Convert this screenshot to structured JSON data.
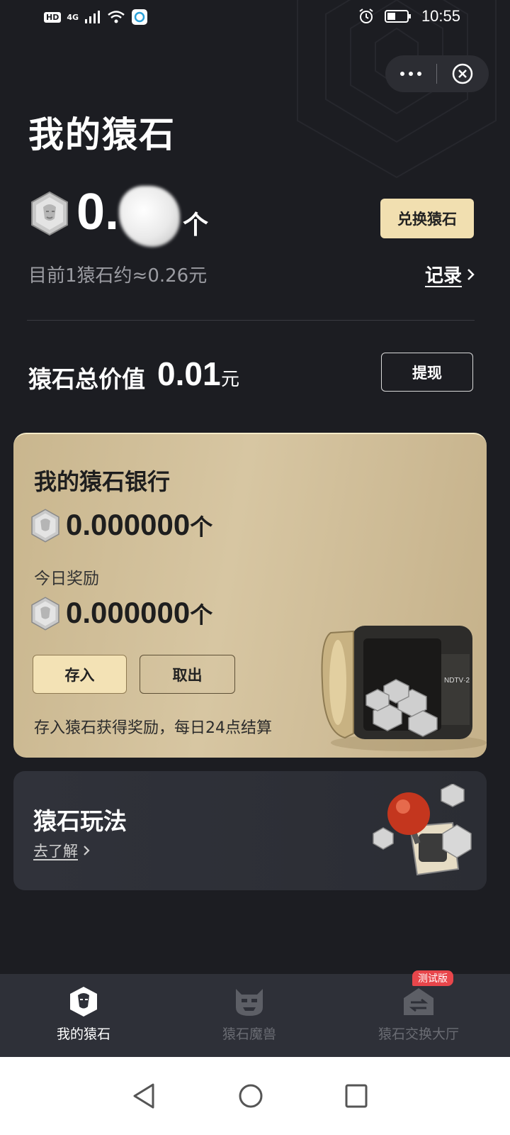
{
  "status_bar": {
    "left_badge_hd": "HD",
    "left_network": "4G",
    "time": "10:55"
  },
  "page": {
    "title": "我的猿石"
  },
  "balance": {
    "amount_visible": "0.",
    "unit": "个",
    "exchange_button": "兑换猿石",
    "rate_text": "目前1猿石约≈0.26元",
    "record_link": "记录"
  },
  "total_value": {
    "label": "猿石总价值",
    "value": "0.01",
    "unit": "元",
    "withdraw_button": "提现"
  },
  "bank": {
    "title": "我的猿石银行",
    "amount": "0.000000",
    "amount_unit": "个",
    "reward_label": "今日奖励",
    "reward_amount": "0.000000",
    "reward_unit": "个",
    "deposit_button": "存入",
    "takeout_button": "取出",
    "note": "存入猿石获得奖励，每日24点结算",
    "safe_label": "NDTV·2"
  },
  "play": {
    "title": "猿石玩法",
    "link": "去了解"
  },
  "tabs": [
    {
      "label": "我的猿石",
      "icon": "ape-stone-icon",
      "active": true
    },
    {
      "label": "猿石魔兽",
      "icon": "monster-icon",
      "active": false
    },
    {
      "label": "猿石交换大厅",
      "icon": "exchange-hall-icon",
      "active": false
    }
  ],
  "test_badge": "测试版",
  "colors": {
    "background": "#1c1d22",
    "accent_gold": "#f1dfb0",
    "card_gold": "#d7c6a2",
    "badge_red": "#e8464b"
  }
}
